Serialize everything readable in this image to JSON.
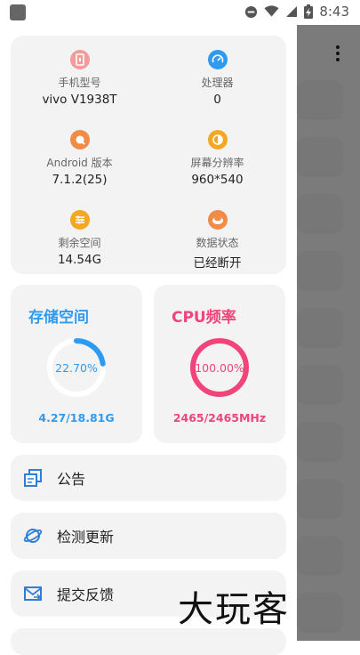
{
  "status_bar": {
    "time": "8:43"
  },
  "device_info": [
    {
      "label": "手机型号",
      "value": "vivo V1938T",
      "icon": "phone-icon",
      "color": "#f39a9a"
    },
    {
      "label": "处理器",
      "value": "0",
      "icon": "processor-icon",
      "color": "#2f9bf0"
    },
    {
      "label": "Android 版本",
      "value": "7.1.2(25)",
      "icon": "android-icon",
      "color": "#f28b46"
    },
    {
      "label": "屏幕分辨率",
      "value": "960*540",
      "icon": "screen-icon",
      "color": "#f5a623"
    },
    {
      "label": "剩余空间",
      "value": "14.54G",
      "icon": "storage-icon",
      "color": "#f5a623"
    },
    {
      "label": "数据状态",
      "value": "已经断开",
      "icon": "data-icon",
      "color": "#f28b46"
    }
  ],
  "storage": {
    "title": "存储空间",
    "percent_text": "22.70%",
    "percent": 22.7,
    "footer": "4.27/18.81G",
    "color": "#2f9bf0"
  },
  "cpu": {
    "title": "CPU频率",
    "percent_text": "100.00%",
    "percent": 100,
    "footer": "2465/2465MHz",
    "color": "#f0447a"
  },
  "menu": [
    {
      "label": "公告",
      "icon": "announcement-icon"
    },
    {
      "label": "检测更新",
      "icon": "update-icon"
    },
    {
      "label": "提交反馈",
      "icon": "feedback-icon"
    }
  ],
  "watermark": "大玩客"
}
